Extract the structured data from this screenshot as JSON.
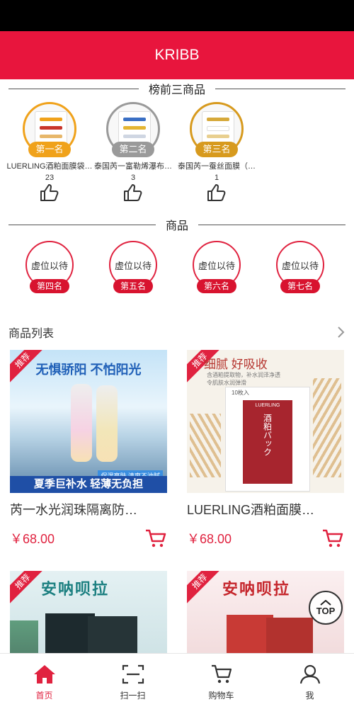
{
  "app": {
    "title": "KRIBB"
  },
  "ranking": {
    "title": "榜前三商品",
    "items": [
      {
        "rank": "第一名",
        "name": "LUERLING酒粕面膜袋…",
        "likes": "23",
        "color": "#f0a21b"
      },
      {
        "rank": "第二名",
        "name": "泰国芮一富勒烯瀑布…",
        "likes": "3",
        "color": "#9a9a9a"
      },
      {
        "rank": "第三名",
        "name": "泰国芮一蚕丝面膜（…",
        "likes": "1",
        "color": "#d79a1e"
      }
    ]
  },
  "goods": {
    "title": "商品",
    "placeholders": [
      {
        "text": "虚位以待",
        "rank": "第四名"
      },
      {
        "text": "虚位以待",
        "rank": "第五名"
      },
      {
        "text": "虚位以待",
        "rank": "第六名"
      },
      {
        "text": "虚位以待",
        "rank": "第七名"
      }
    ]
  },
  "product_list": {
    "title": "商品列表",
    "products": [
      {
        "tag": "推荐",
        "headline": "无惧骄阳 不怕阳光",
        "banner": "夏季巨补水 轻薄无负担",
        "sub1": "保湿亮肤",
        "sub2": "清爽不油腻",
        "title": "芮一水光润珠隔离防…",
        "price": "￥68.00"
      },
      {
        "tag": "推荐",
        "headline": "细腻 好吸收",
        "sub1": "含酒粕提取物，补水润泽净透",
        "sub2": "令肌肤水润弹滑",
        "box_brand": "LUERLING",
        "box_text": "酒粕パック",
        "badge": "10枚入",
        "title": "LUERLING酒粕面膜…",
        "price": "￥68.00"
      },
      {
        "tag": "推荐",
        "headline": "安呐呗拉",
        "title": "",
        "price": ""
      },
      {
        "tag": "推荐",
        "headline": "安呐呗拉",
        "title": "",
        "price": ""
      }
    ]
  },
  "top_button": {
    "label": "TOP"
  },
  "bottom_nav": [
    {
      "label": "首页",
      "icon": "home-icon",
      "active": true
    },
    {
      "label": "扫一扫",
      "icon": "scan-icon",
      "active": false
    },
    {
      "label": "购物车",
      "icon": "cart-icon",
      "active": false
    },
    {
      "label": "我",
      "icon": "user-icon",
      "active": false
    }
  ],
  "colors": {
    "brand": "#e8153d",
    "accent": "#e0223f"
  }
}
